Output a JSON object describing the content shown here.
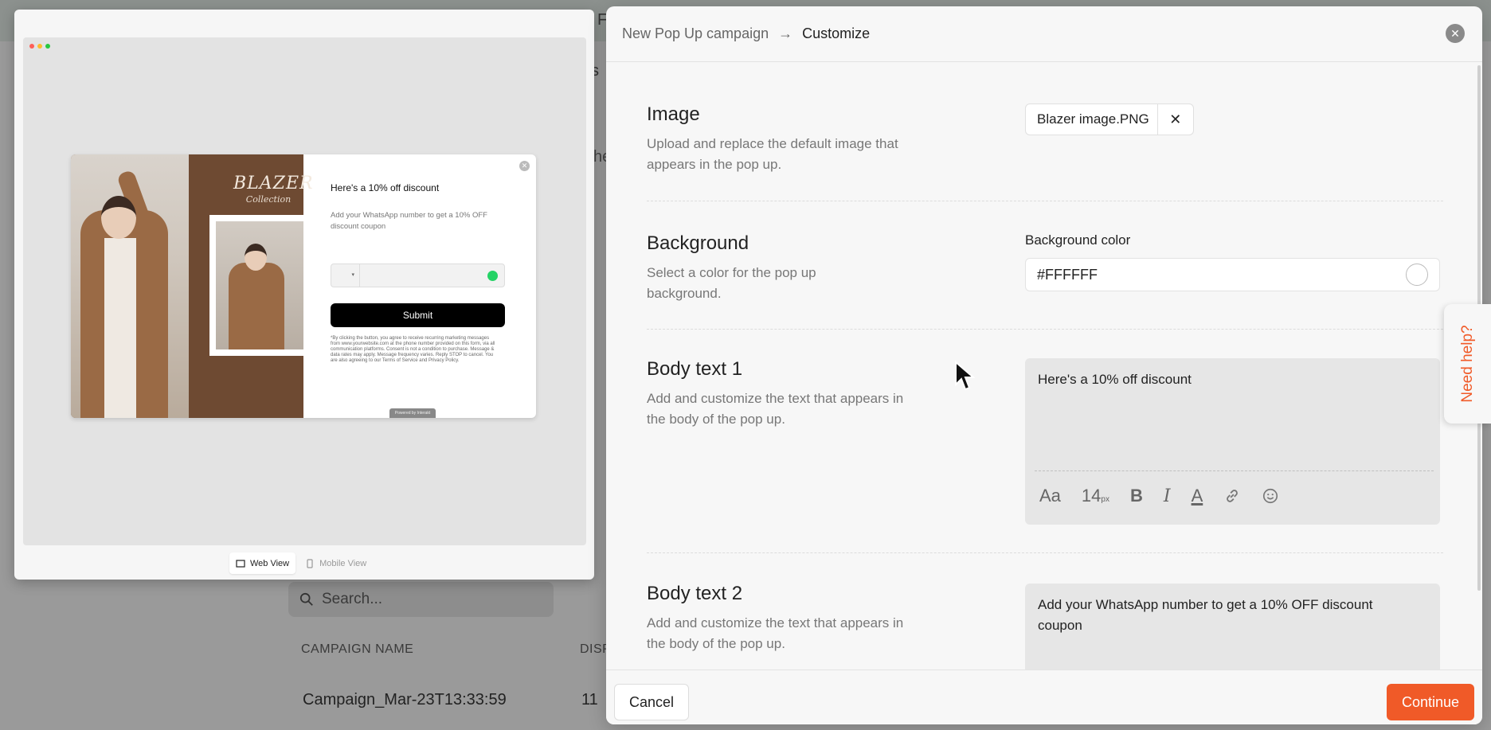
{
  "background_app": {
    "topbar_fragment": "F",
    "tabs_fragment": "s",
    "side_fragment": "he",
    "search_placeholder": "Search...",
    "columns": [
      "CAMPAIGN NAME",
      "DISP"
    ],
    "rows": [
      {
        "name": "Campaign_Mar-23T13:33:59",
        "value": "11"
      }
    ]
  },
  "preview": {
    "popup": {
      "brand": "BLAZER",
      "brand_sub": "Collection",
      "title": "Here's a 10% off discount",
      "body": "Add your WhatsApp number to get a 10% OFF discount coupon",
      "submit": "Submit",
      "legal": "*By clicking the button, you agree to receive recurring marketing messages from www.yourwebsite.com at the phone number provided on this form, via all communication platforms. Consent is not a condition to purchase. Message & data rates may apply. Message frequency varies. Reply STOP to cancel. You are also agreeing to our Terms of Service and Privacy Policy.",
      "powered": "Powered by Interakt"
    },
    "views": {
      "web": "Web View",
      "mobile": "Mobile View",
      "active": "web"
    }
  },
  "panel": {
    "breadcrumb": {
      "parent": "New Pop Up campaign",
      "arrow": "→",
      "current": "Customize"
    },
    "close_icon": "close-icon",
    "sections": {
      "image": {
        "title": "Image",
        "desc": "Upload and replace the default image that appears in the pop up.",
        "file_name": "Blazer image.PNG",
        "remove": "✕"
      },
      "background": {
        "title": "Background",
        "desc": "Select a color for the pop up background.",
        "label": "Background color",
        "value": "#FFFFFF"
      },
      "body1": {
        "title": "Body text 1",
        "desc": "Add and customize the text that appears in the body of the pop up.",
        "value": "Here's a 10% off discount"
      },
      "body2": {
        "title": "Body text 2",
        "desc": "Add and customize the text that appears in the body of the pop up.",
        "value": "Add your WhatsApp number to get a 10% OFF discount coupon"
      }
    },
    "toolbar": {
      "font": "Aa",
      "size": "14",
      "size_unit": "px",
      "bold": "B",
      "italic": "I",
      "color": "A"
    },
    "footer": {
      "cancel": "Cancel",
      "continue": "Continue"
    }
  },
  "help": {
    "label": "Need help?"
  },
  "colors": {
    "accent": "#f05a28",
    "popup_brown": "#6e4a32",
    "whatsapp": "#25d366"
  }
}
